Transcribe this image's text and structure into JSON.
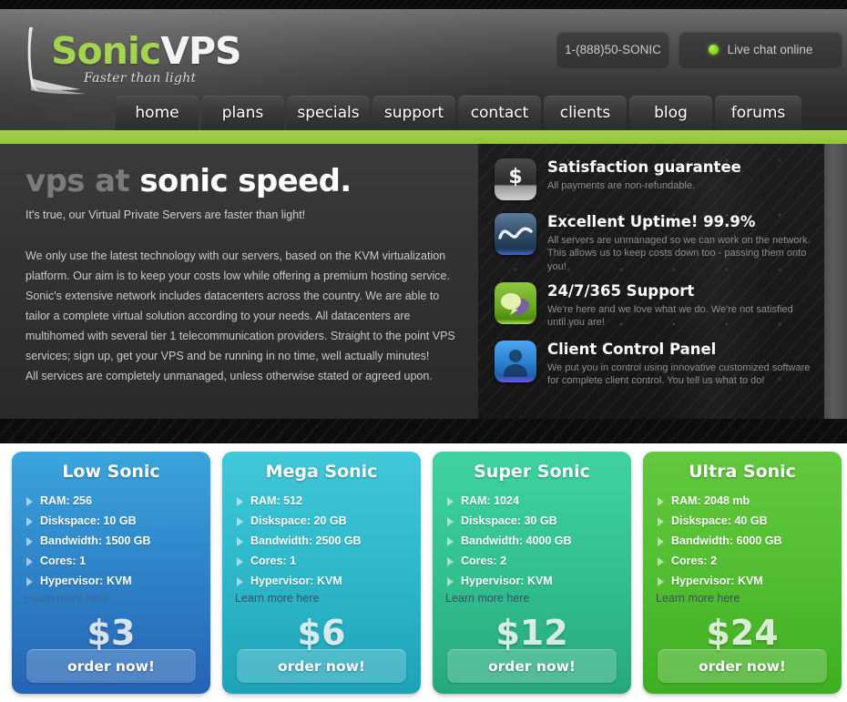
{
  "header": {
    "logo": {
      "brand_first": "Sonic",
      "brand_second": "VPS",
      "tagline": "Faster than light"
    },
    "phone": "1-(888)50-SONIC",
    "chat": "Live chat online",
    "accent_green": "#9bcf3c"
  },
  "nav": {
    "items": [
      {
        "label": "home"
      },
      {
        "label": "plans"
      },
      {
        "label": "specials"
      },
      {
        "label": "support"
      },
      {
        "label": "contact"
      },
      {
        "label": "clients"
      },
      {
        "label": "blog"
      },
      {
        "label": "forums"
      }
    ]
  },
  "hero": {
    "headline_dim": "vps at ",
    "headline_bright": "sonic speed.",
    "subhead": "It's true, our Virtual Private Servers are faster than light!",
    "paragraphs": [
      "We only use the latest technology with our servers, based on the KVM virtualization platform. Our aim is to keep your costs low while offering a premium hosting service. Sonic's extensive network includes datacenters across the country. We are able to tailor a complete virtual solution according to your needs. All datacenters are multihomed with several tier 1 telecommunication providers. Straight to the point VPS services; sign up, get your VPS and be running in no time, well actually minutes!",
      "All services are completely unmanaged, unless otherwise stated or agreed upon."
    ]
  },
  "features": [
    {
      "icon": "dollar-icon",
      "title": "Satisfaction guarantee",
      "desc": "All payments are non-refundable."
    },
    {
      "icon": "uptime-wave-icon",
      "title": "Excellent Uptime! 99.9%",
      "desc": "All servers are unmanaged so we can work on the network. This allows us to keep costs down too - passing them onto you!"
    },
    {
      "icon": "support-chat-icon",
      "title": "24/7/365 Support",
      "desc": "We're here and we love what we do. We're not satisfied until you are!"
    },
    {
      "icon": "client-person-icon",
      "title": "Client Control Panel",
      "desc": "We put you in control using innovative customized software for complete client control. You tell us what to do!"
    }
  ],
  "plans": {
    "learn_more_label": "Learn more here",
    "order_label": "order now!",
    "cards": [
      {
        "name": "Low Sonic",
        "color": "#2f86c9",
        "specs": [
          "RAM: 256",
          "Diskspace: 10 GB",
          "Bandwidth: 1500 GB",
          "Cores: 1",
          "Hypervisor: KVM"
        ],
        "price": "$3"
      },
      {
        "name": "Mega Sonic",
        "color": "#2fb9cb",
        "specs": [
          "RAM: 512",
          "Diskspace: 20 GB",
          "Bandwidth: 2500 GB",
          "Cores: 1",
          "Hypervisor: KVM"
        ],
        "price": "$6"
      },
      {
        "name": "Super Sonic",
        "color": "#34c292",
        "specs": [
          "RAM: 1024",
          "Diskspace: 30 GB",
          "Bandwidth: 4000 GB",
          "Cores: 2",
          "Hypervisor: KVM"
        ],
        "price": "$12"
      },
      {
        "name": "Ultra Sonic",
        "color": "#54bf31",
        "specs": [
          "RAM: 2048 mb",
          "Diskspace: 40 GB",
          "Bandwidth: 6000 GB",
          "Cores: 2",
          "Hypervisor: KVM"
        ],
        "price": "$24"
      }
    ]
  }
}
